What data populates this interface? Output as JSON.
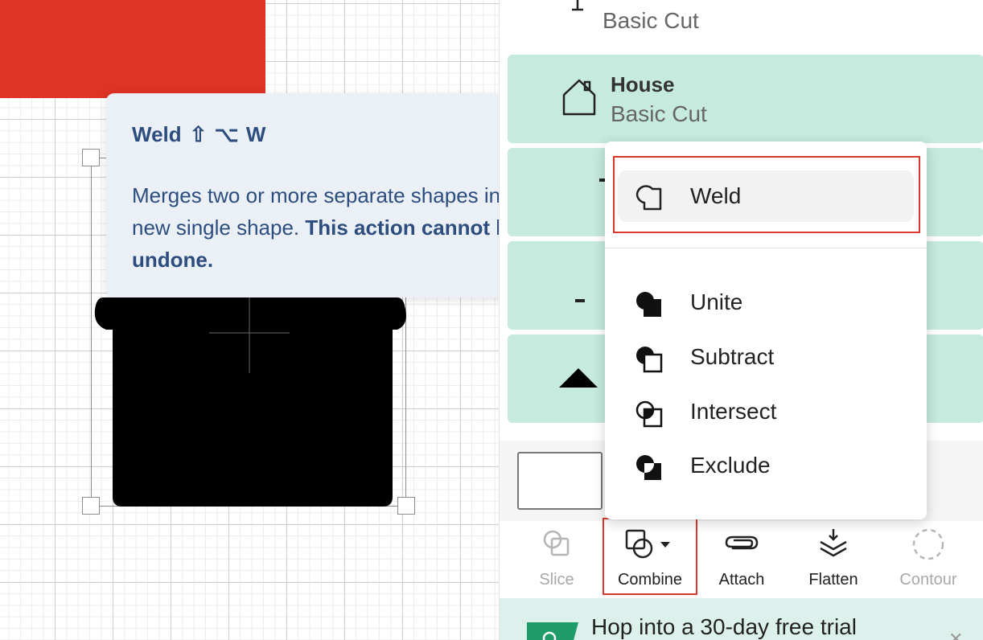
{
  "tooltip": {
    "title": "Weld",
    "shortcut": "⇧ ⌥ W",
    "desc_plain": "Merges two or more separate shapes into a new single shape. ",
    "desc_bold": "This action cannot be undone."
  },
  "layers": {
    "row0": {
      "subtitle": "Basic Cut",
      "icon": "text-icon"
    },
    "row1": {
      "name": "House",
      "subtitle": "Basic Cut",
      "icon": "house-icon"
    },
    "row4": {
      "icon": "triangle-icon"
    }
  },
  "dropdown": {
    "items": [
      {
        "label": "Weld",
        "icon": "weld-icon"
      },
      {
        "label": "Unite",
        "icon": "unite-icon"
      },
      {
        "label": "Subtract",
        "icon": "subtract-icon"
      },
      {
        "label": "Intersect",
        "icon": "intersect-icon"
      },
      {
        "label": "Exclude",
        "icon": "exclude-icon"
      }
    ]
  },
  "toolbar": {
    "slice": "Slice",
    "combine": "Combine",
    "attach": "Attach",
    "flatten": "Flatten",
    "contour": "Contour"
  },
  "promo": {
    "text": "Hop into a 30-day free trial"
  },
  "colors": {
    "accent_red": "#de3327",
    "layer_green": "#c6eadd",
    "tooltip_bg": "#ebf0f7",
    "tooltip_text": "#2c4d7d"
  }
}
